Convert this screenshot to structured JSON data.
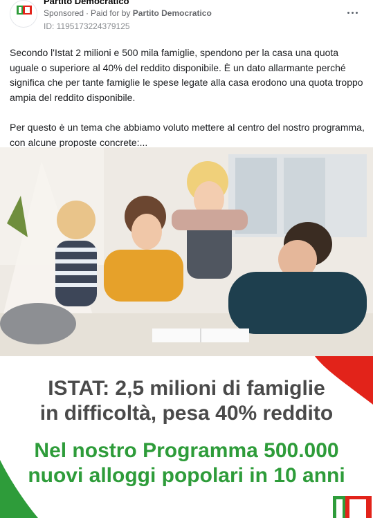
{
  "header": {
    "page_name": "Partito Democratico",
    "sponsored_label": "Sponsored",
    "separator": "·",
    "paid_for_label": "Paid for by",
    "paid_for_name": "Partito Democratico",
    "ad_id": "ID: 1195173224379125",
    "avatar_text": "Partito Democratico",
    "more_icon": "more-horizontal-icon"
  },
  "post": {
    "paragraph_1": "Secondo l'Istat 2 milioni e 500 mila famiglie, spendono per la casa una quota uguale o superiore al 40% del reddito disponibile. È un dato allarmante perché significa che per tante famiglie le spese legate alla casa erodono una quota troppo ampia del reddito disponibile.",
    "paragraph_2": "Per questo è un tema che abbiamo voluto mettere al centro del nostro programma, con alcune proposte concrete:..."
  },
  "creative": {
    "headline_line_1": "ISTAT: 2,5 milioni di famiglie",
    "headline_line_2": "in difficoltà, pesa 40% reddito",
    "headline_line_3": "Nel nostro Programma 500.000",
    "headline_line_4": "nuovi alloggi popolari in 10 anni",
    "colors": {
      "gray_text": "#4a4a4a",
      "green_text": "#2e9c3a",
      "accent_red": "#e2231a",
      "accent_green": "#2e9c3a"
    }
  }
}
